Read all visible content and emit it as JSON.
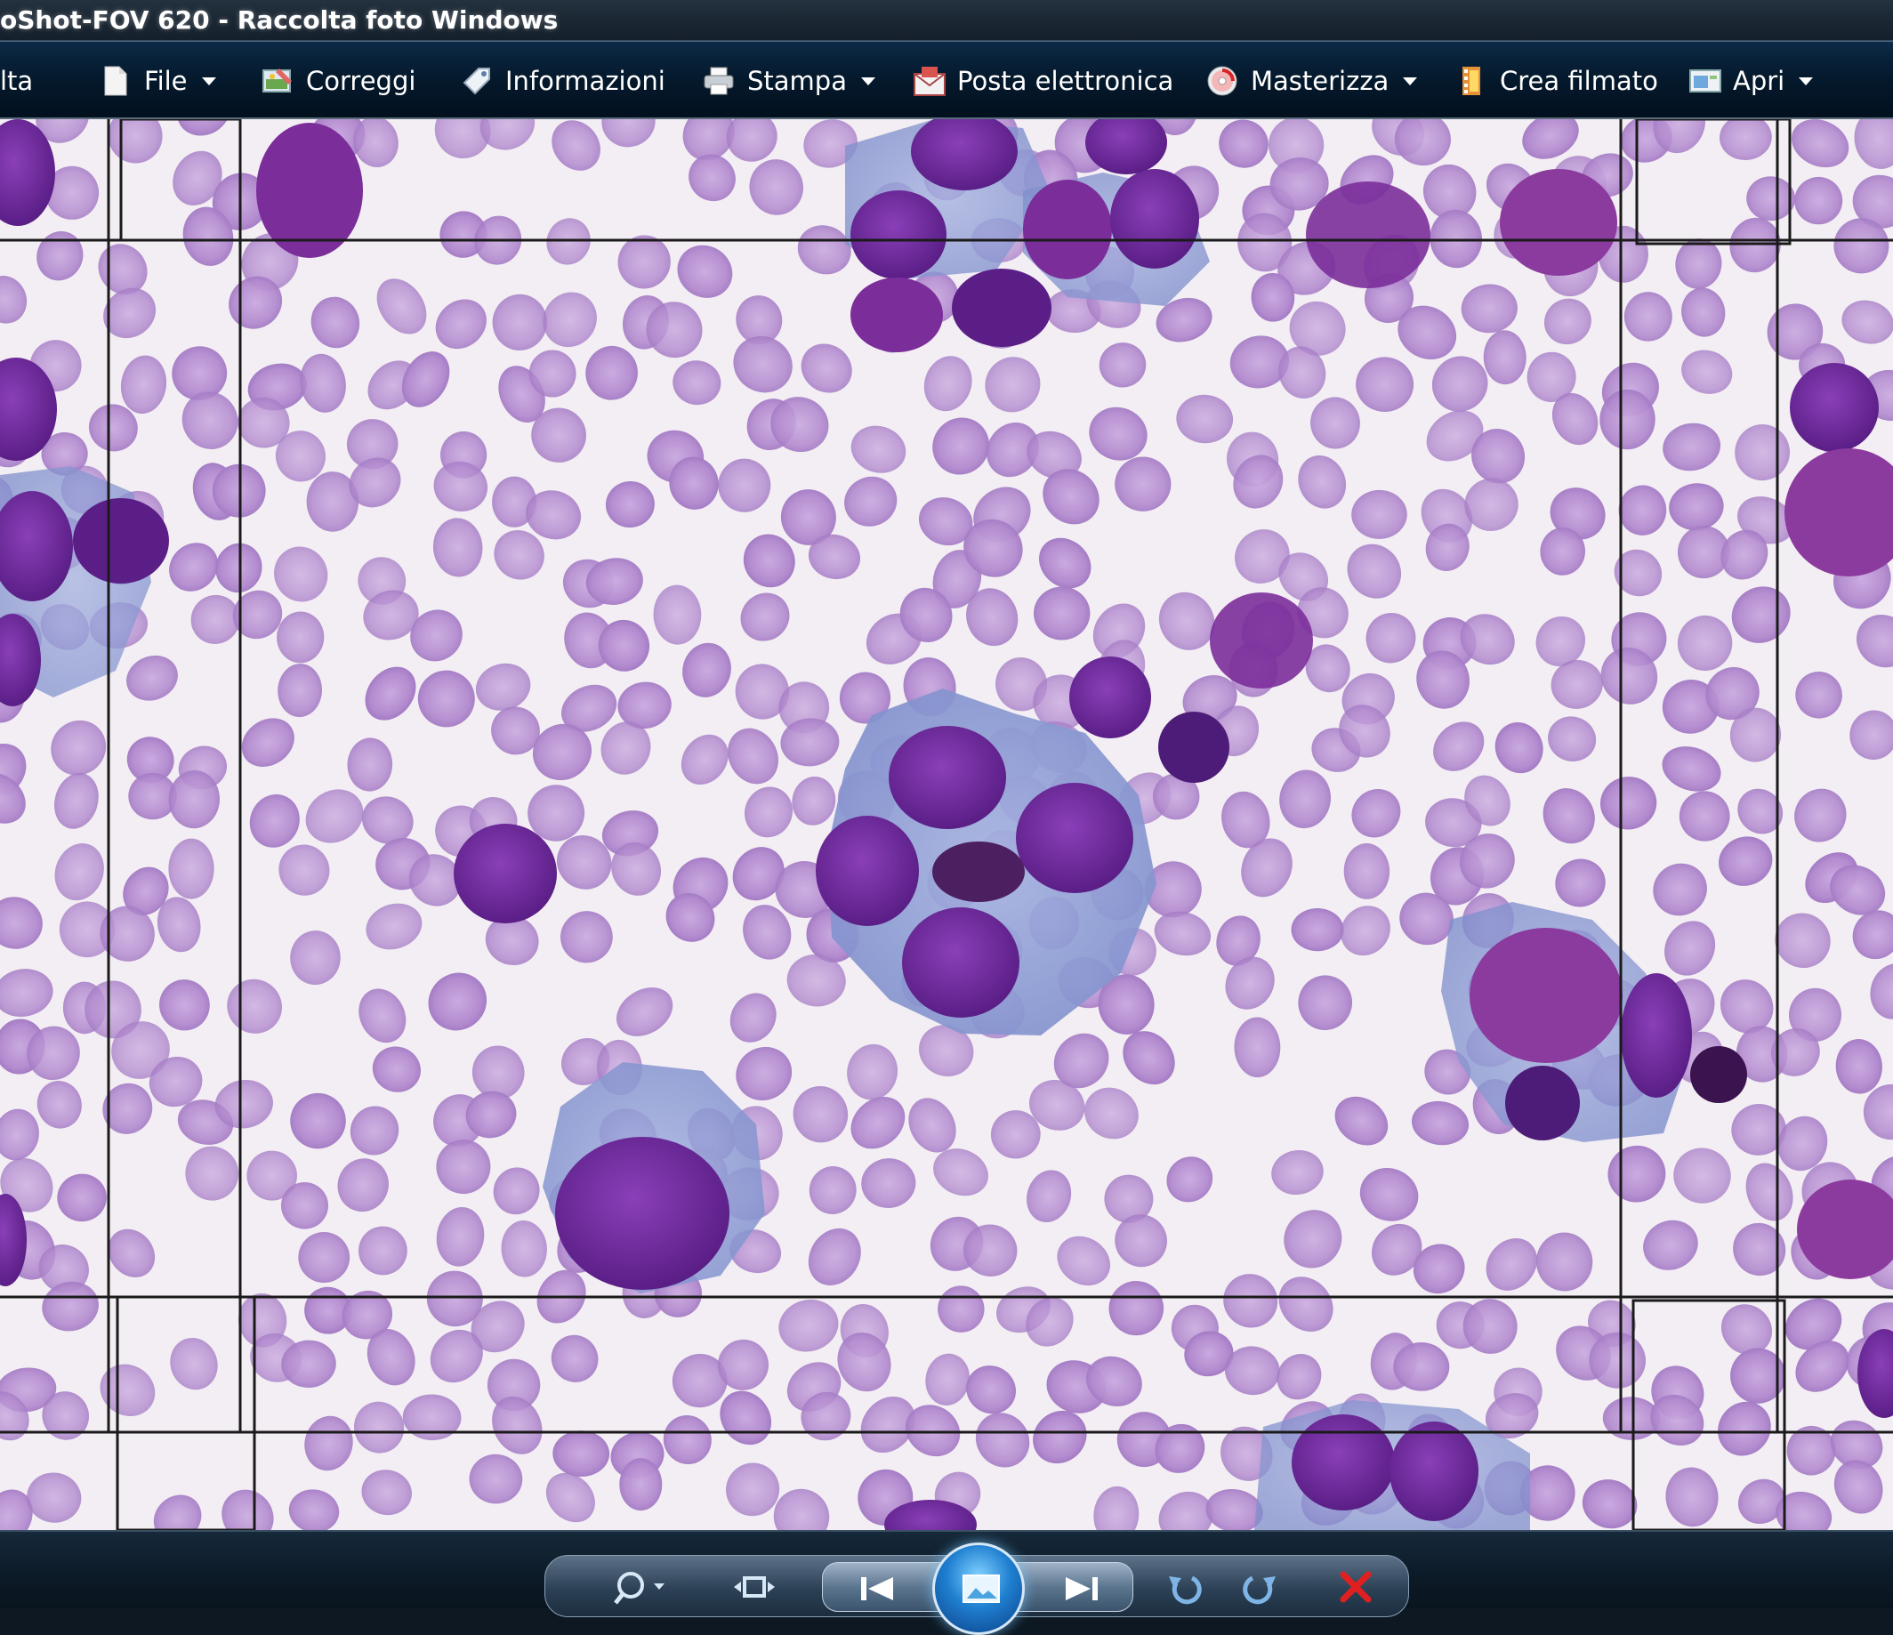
{
  "window": {
    "title": "oShot-FOV 620 - Raccolta foto Windows"
  },
  "toolbar": {
    "items": [
      {
        "label": "lta",
        "icon": "none"
      },
      {
        "label": "File",
        "icon": "file-icon",
        "dropdown": true
      },
      {
        "label": "Correggi",
        "icon": "fix-icon",
        "dropdown": false
      },
      {
        "label": "Informazioni",
        "icon": "info-tag-icon",
        "dropdown": false
      },
      {
        "label": "Stampa",
        "icon": "printer-icon",
        "dropdown": true
      },
      {
        "label": "Posta elettronica",
        "icon": "email-icon",
        "dropdown": false
      },
      {
        "label": "Masterizza",
        "icon": "burn-disc-icon",
        "dropdown": true
      },
      {
        "label": "Crea filmato",
        "icon": "film-icon",
        "dropdown": false
      },
      {
        "label": "Apri",
        "icon": "open-icon",
        "dropdown": true
      }
    ]
  },
  "viewer": {
    "image_subject": "blood-smear-micrograph",
    "colors": {
      "background": "#f3eef3",
      "rbc": "#b58fd0",
      "rbc_center": "#c7a6de",
      "nucleus": "#6a2a98",
      "cytoplasm": "#8ea0d6",
      "grid": "#1a1a1a"
    }
  },
  "controls": {
    "buttons": [
      {
        "name": "zoom-icon"
      },
      {
        "name": "actual-size-icon"
      },
      {
        "name": "previous-icon"
      },
      {
        "name": "slideshow-icon"
      },
      {
        "name": "next-icon"
      },
      {
        "name": "rotate-left-icon"
      },
      {
        "name": "rotate-right-icon"
      },
      {
        "name": "delete-icon"
      }
    ]
  }
}
